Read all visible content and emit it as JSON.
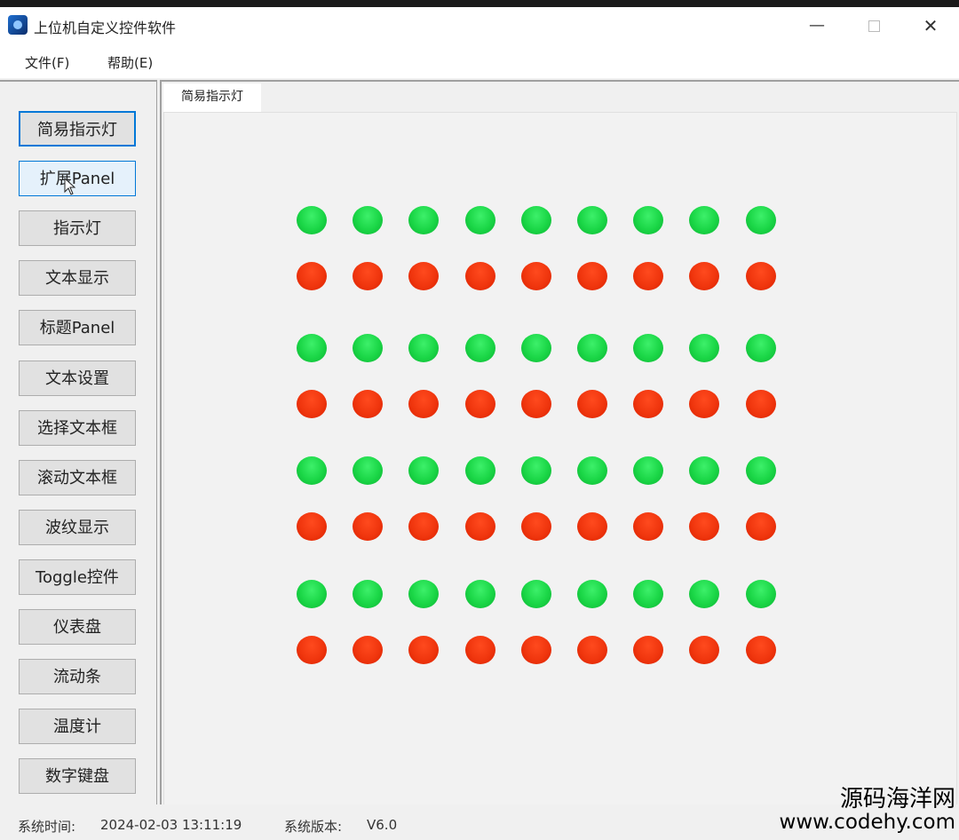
{
  "window": {
    "title": "上位机自定义控件软件",
    "controls": {
      "minimize": "—",
      "close": "✕"
    }
  },
  "menu": {
    "file": "文件(F)",
    "help": "帮助(E)"
  },
  "sidebar": {
    "active_index": 0,
    "hover_index": 1,
    "items": [
      {
        "label": "简易指示灯"
      },
      {
        "label": "扩展Panel"
      },
      {
        "label": "指示灯"
      },
      {
        "label": "文本显示"
      },
      {
        "label": "标题Panel"
      },
      {
        "label": "文本设置"
      },
      {
        "label": "选择文本框"
      },
      {
        "label": "滚动文本框"
      },
      {
        "label": "波纹显示"
      },
      {
        "label": "Toggle控件"
      },
      {
        "label": "仪表盘"
      },
      {
        "label": "流动条"
      },
      {
        "label": "温度计"
      },
      {
        "label": "数字键盘"
      }
    ]
  },
  "tab": {
    "label": "简易指示灯"
  },
  "indicator_grid": {
    "rows": [
      "green",
      "red",
      "green",
      "red",
      "green",
      "red",
      "green",
      "red"
    ],
    "columns": 9,
    "colors": {
      "green": "#1ad646",
      "red": "#f0360e"
    }
  },
  "status": {
    "time_label": "系统时间:",
    "time_value": "2024-02-03 13:11:19",
    "version_label": "系统版本:",
    "version_value": "V6.0"
  },
  "watermark": {
    "line1": "源码海洋网",
    "line2": "www.codehy.com"
  }
}
